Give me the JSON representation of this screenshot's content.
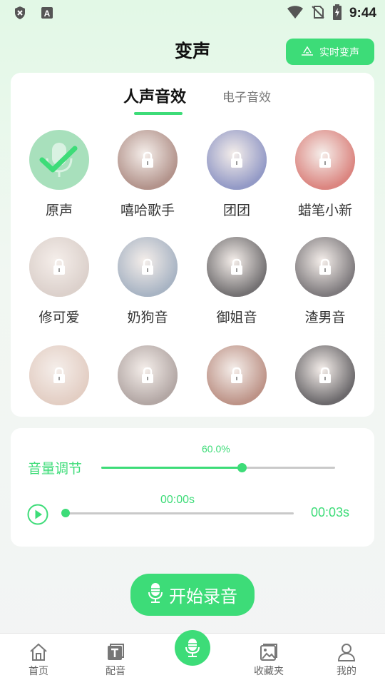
{
  "status_bar": {
    "time": "9:44"
  },
  "header": {
    "title": "变声",
    "realtime_button": "实时变声"
  },
  "tabs": [
    {
      "label": "人声音效",
      "active": true
    },
    {
      "label": "电子音效",
      "active": false
    }
  ],
  "voices": [
    {
      "label": "原声",
      "locked": false,
      "color": "#a8e0bc"
    },
    {
      "label": "嘻哈歌手",
      "locked": true,
      "color": "#8a5a4e"
    },
    {
      "label": "团团",
      "locked": true,
      "color": "#5a64a8"
    },
    {
      "label": "蜡笔小新",
      "locked": true,
      "color": "#c8443c"
    },
    {
      "label": "修可爱",
      "locked": true,
      "color": "#c9b8b0"
    },
    {
      "label": "奶狗音",
      "locked": true,
      "color": "#7a8ca4"
    },
    {
      "label": "御姐音",
      "locked": true,
      "color": "#2a2628"
    },
    {
      "label": "渣男音",
      "locked": true,
      "color": "#3a3438"
    },
    {
      "label": "",
      "locked": true,
      "color": "#d4b4a4"
    },
    {
      "label": "",
      "locked": true,
      "color": "#8a7874"
    },
    {
      "label": "",
      "locked": true,
      "color": "#9a5a48"
    },
    {
      "label": "",
      "locked": true,
      "color": "#1e1a1e"
    }
  ],
  "controls": {
    "volume_label": "音量调节",
    "volume_percent": "60.0%",
    "volume_value": 0.6,
    "time_current": "00:00s",
    "time_total": "00:03s",
    "playback_progress": 0.0
  },
  "record_button": "开始录音",
  "nav": {
    "home": "首页",
    "dubbing": "配音",
    "favorites": "收藏夹",
    "mine": "我的"
  },
  "colors": {
    "accent": "#3ddc78"
  }
}
